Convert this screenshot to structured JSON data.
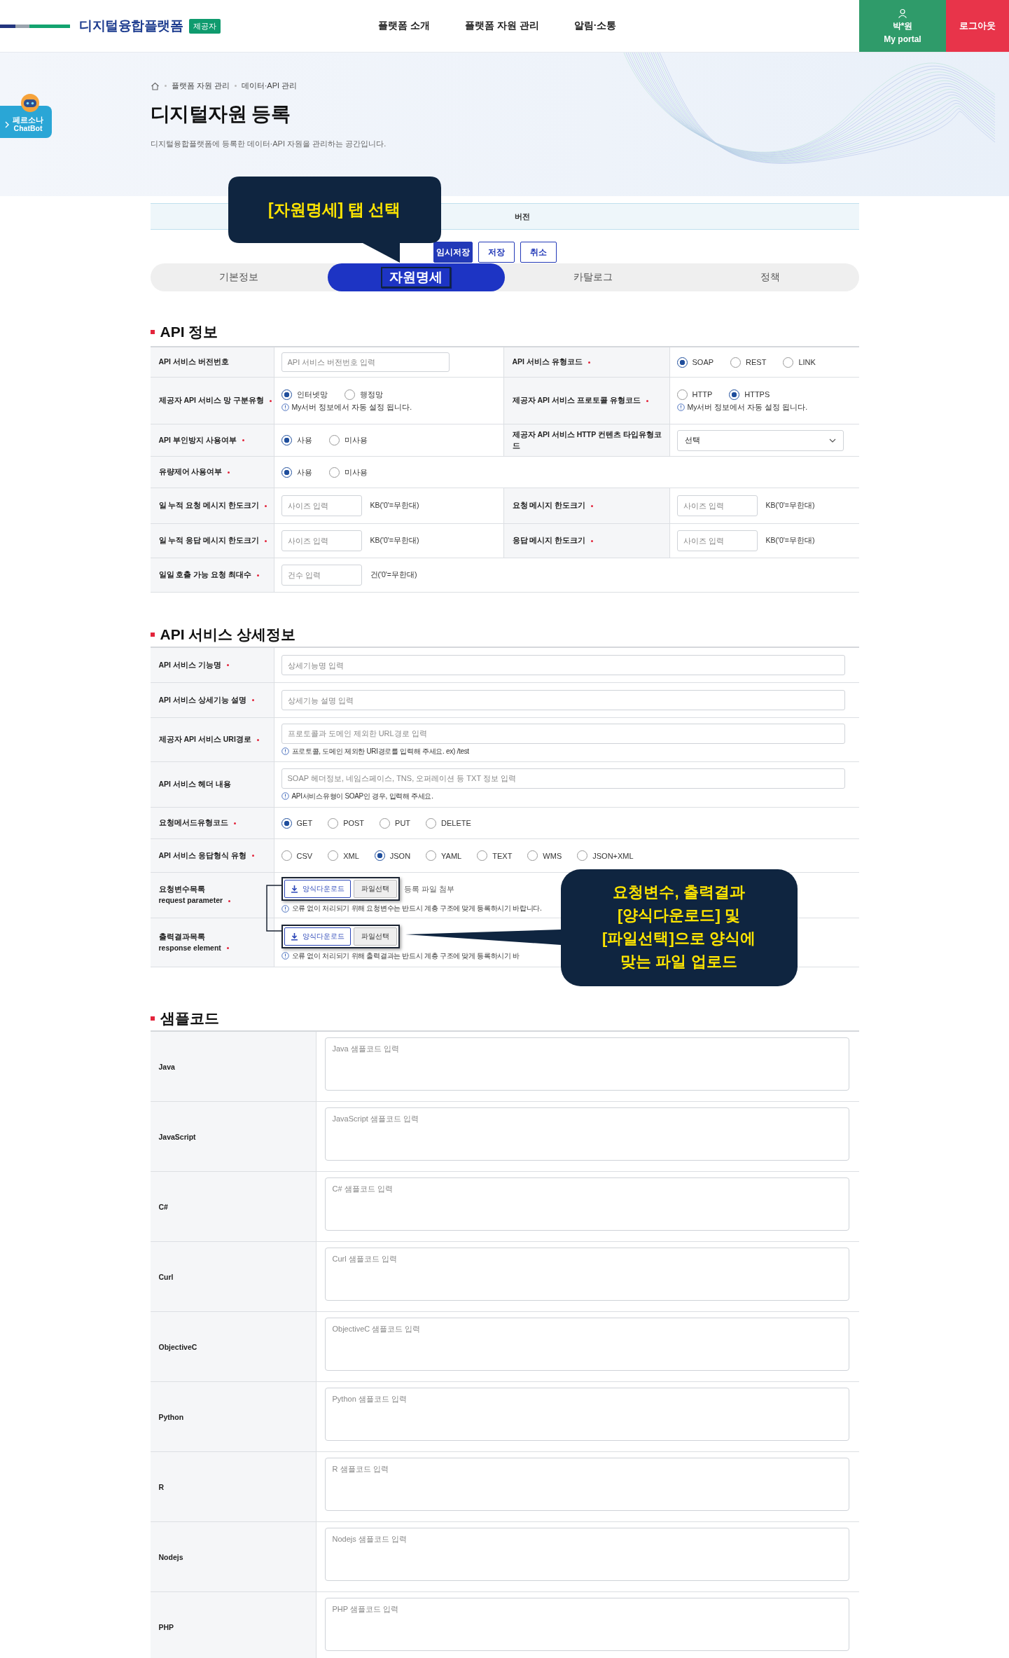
{
  "header": {
    "logo_text": "디지털융합플랫폼",
    "logo_badge": "제공자",
    "nav": [
      "플랫폼 소개",
      "플랫폼 자원 관리",
      "알림·소통"
    ],
    "user_name": "박*원",
    "portal_label": "My portal",
    "logout": "로그아웃"
  },
  "chatbot": {
    "label_lines": [
      "페르소나",
      "ChatBot"
    ]
  },
  "breadcrumb": [
    "플랫폼 자원 관리",
    "데이터·API 관리"
  ],
  "page_title": "디지털자원 등록",
  "page_description": "디지털융합플랫폼에 등록한 데이터·API 자원을 관리하는 공간입니다.",
  "version_bar": {
    "label": "버전"
  },
  "action_buttons": [
    {
      "label": "임시저장",
      "kind": "primary"
    },
    {
      "label": "저장",
      "kind": "outline"
    },
    {
      "label": "취소",
      "kind": "outline"
    }
  ],
  "tabs": [
    {
      "label": "기본정보",
      "selected": false
    },
    {
      "label": "자원명세",
      "selected": true
    },
    {
      "label": "카탈로그",
      "selected": false
    },
    {
      "label": "정책",
      "selected": false
    }
  ],
  "tab_callout": {
    "text": "[자원명세] 탭 선택"
  },
  "api_info": {
    "title": "API 정보",
    "rows": [
      {
        "fields": [
          {
            "label": "API 서비스 버전번호",
            "required": false,
            "kind": "text",
            "placeholder": "API 서비스 버전번호 입력"
          },
          {
            "label": "API 서비스 유형코드",
            "required": true,
            "kind": "radio",
            "options": [
              {
                "label": "SOAP",
                "selected": true
              },
              {
                "label": "REST",
                "selected": false
              },
              {
                "label": "LINK",
                "selected": false
              }
            ]
          }
        ]
      },
      {
        "fields": [
          {
            "label": "제공자 API 서비스 망 구분유형",
            "required": true,
            "kind": "radio",
            "options": [
              {
                "label": "인터넷망",
                "selected": true
              },
              {
                "label": "행정망",
                "selected": false
              }
            ],
            "note": "My서버 정보에서 자동 설정 됩니다."
          },
          {
            "label": "제공자 API 서비스 프로토콜 유형코드",
            "required": true,
            "kind": "radio",
            "options": [
              {
                "label": "HTTP",
                "selected": false
              },
              {
                "label": "HTTPS",
                "selected": true
              }
            ],
            "note": "My서버 정보에서 자동 설정 됩니다."
          }
        ]
      },
      {
        "fields": [
          {
            "label": "API 부인방지 사용여부",
            "required": true,
            "kind": "radio",
            "options": [
              {
                "label": "사용",
                "selected": true
              },
              {
                "label": "미사용",
                "selected": false
              }
            ]
          },
          {
            "label": "제공자 API 서비스 HTTP 컨텐츠 타입유형코드",
            "required": false,
            "kind": "select",
            "value": "선택"
          }
        ]
      },
      {
        "fields": [
          {
            "label": "유량제어 사용여부",
            "required": true,
            "kind": "radio",
            "options": [
              {
                "label": "사용",
                "selected": true
              },
              {
                "label": "미사용",
                "selected": false
              }
            ]
          }
        ]
      },
      {
        "fields": [
          {
            "label": "일 누적 요청 메시지 한도크기",
            "required": true,
            "kind": "unit",
            "placeholder": "사이즈 입력",
            "unit": "KB('0'=무한대)"
          },
          {
            "label": "요청 메시지 한도크기",
            "required": true,
            "kind": "unit",
            "placeholder": "사이즈 입력",
            "unit": "KB('0'=무한대)"
          }
        ]
      },
      {
        "fields": [
          {
            "label": "일 누적 응답 메시지 한도크기",
            "required": true,
            "kind": "unit",
            "placeholder": "사이즈 입력",
            "unit": "KB('0'=무한대)"
          },
          {
            "label": "응답 메시지 한도크기",
            "required": true,
            "kind": "unit",
            "placeholder": "사이즈 입력",
            "unit": "KB('0'=무한대)"
          }
        ]
      },
      {
        "fields": [
          {
            "label": "일일 호출 가능 요청 최대수",
            "required": true,
            "kind": "unit",
            "placeholder": "건수 입력",
            "unit": "건('0'=무한대)"
          }
        ]
      }
    ]
  },
  "service_detail": {
    "title": "API 서비스 상세정보",
    "rows": [
      {
        "label": "API 서비스 기능명",
        "required": true,
        "kind": "text",
        "placeholder": "상세기능명 입력"
      },
      {
        "label": "API 서비스 상세기능 설명",
        "required": true,
        "kind": "text",
        "placeholder": "상세기능 설명 입력"
      },
      {
        "label": "제공자 API 서비스 URI경로",
        "required": true,
        "kind": "text",
        "placeholder": "프로토콜과 도메인 제외한 URL경로 입력",
        "note": "프로토콜, 도메인 제외한 URI경로를 입력해 주세요. ex) /test"
      },
      {
        "label": "API 서비스 헤더 내용",
        "required": false,
        "kind": "text",
        "placeholder": "SOAP 헤더정보, 네임스페이스, TNS, 오퍼레이션 등 TXT 정보 입력",
        "note": "API서비스유형이 SOAP인 경우, 입력해 주세요."
      },
      {
        "label": "요청메서드유형코드",
        "required": true,
        "kind": "radio",
        "options": [
          {
            "label": "GET",
            "selected": true
          },
          {
            "label": "POST",
            "selected": false
          },
          {
            "label": "PUT",
            "selected": false
          },
          {
            "label": "DELETE",
            "selected": false
          }
        ]
      },
      {
        "label": "API 서비스 응답형식 유형",
        "required": true,
        "kind": "radio",
        "options": [
          {
            "label": "CSV",
            "selected": false
          },
          {
            "label": "XML",
            "selected": false
          },
          {
            "label": "JSON",
            "selected": true
          },
          {
            "label": "YAML",
            "selected": false
          },
          {
            "label": "TEXT",
            "selected": false
          },
          {
            "label": "WMS",
            "selected": false
          },
          {
            "label": "JSON+XML",
            "selected": false
          }
        ]
      },
      {
        "label": "요청변수목록",
        "sublabel": "request parameter",
        "required": true,
        "kind": "file",
        "download": "양식다운로드",
        "choose": "파일선택",
        "file_label": "등록 파일 첨부",
        "note": "오류 없이 처리되기 위해 요청변수는 반드시 계층 구조에 맞게 등록하시기 바랍니다."
      },
      {
        "label": "출력결과목록",
        "sublabel": "response element",
        "required": true,
        "kind": "file",
        "download": "양식다운로드",
        "choose": "파일선택",
        "note": "오류 없이 처리되기 위해 출력결과는 반드시 계층 구조에 맞게 등록하시기 바"
      }
    ]
  },
  "file_callout": {
    "lines": [
      "요청변수, 출력결과",
      "[양식다운로드] 및",
      "[파일선택]으로 양식에",
      "맞는 파일 업로드"
    ]
  },
  "sample_code": {
    "title": "샘플코드",
    "rows": [
      {
        "label": "Java",
        "placeholder": "Java 샘플코드 입력"
      },
      {
        "label": "JavaScript",
        "placeholder": "JavaScript 샘플코드 입력"
      },
      {
        "label": "C#",
        "placeholder": "C# 샘플코드 입력"
      },
      {
        "label": "Curl",
        "placeholder": "Curl 샘플코드 입력"
      },
      {
        "label": "ObjectiveC",
        "placeholder": "ObjectiveC 샘플코드 입력"
      },
      {
        "label": "Python",
        "placeholder": "Python 샘플코드 입력"
      },
      {
        "label": "R",
        "placeholder": "R 샘플코드 입력"
      },
      {
        "label": "Nodejs",
        "placeholder": "Nodejs 샘플코드 입력"
      },
      {
        "label": "PHP",
        "placeholder": "PHP 샘플코드 입력"
      }
    ]
  }
}
